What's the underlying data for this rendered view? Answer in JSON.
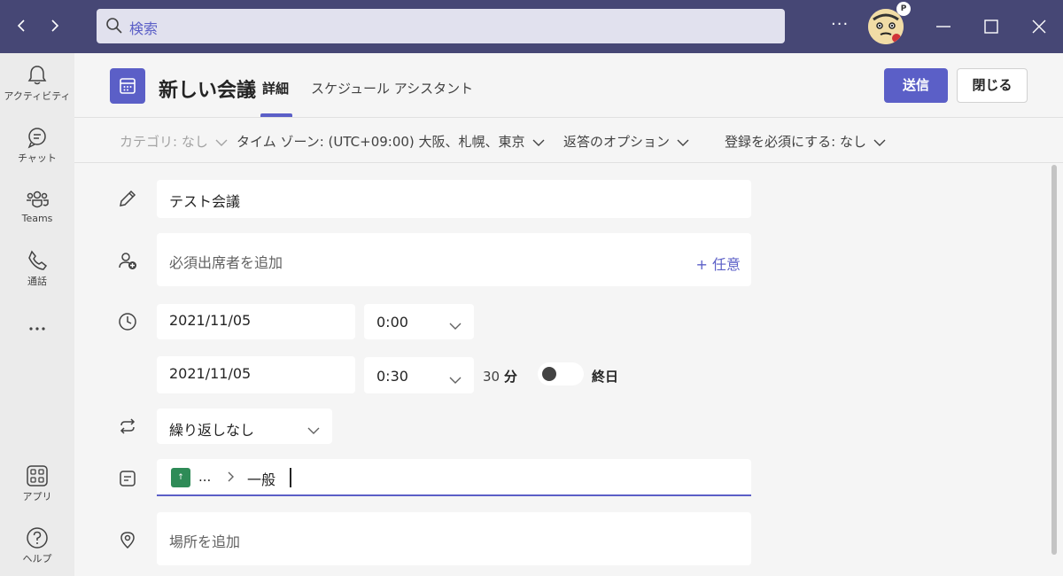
{
  "search": {
    "placeholder": "検索"
  },
  "rail": [
    {
      "label": "アクティビティ",
      "icon": "bell-icon"
    },
    {
      "label": "チャット",
      "icon": "chat-icon"
    },
    {
      "label": "Teams",
      "icon": "teams-icon"
    },
    {
      "label": "通話",
      "icon": "phone-icon"
    },
    {
      "label": "アプリ",
      "icon": "apps-icon"
    },
    {
      "label": "ヘルプ",
      "icon": "help-icon"
    }
  ],
  "user": {
    "presence_badge": "P"
  },
  "header": {
    "title": "新しい会議",
    "tabs": [
      {
        "label": "詳細",
        "active": true
      },
      {
        "label": "スケジュール アシスタント",
        "active": false
      }
    ],
    "send_label": "送信",
    "close_label": "閉じる"
  },
  "options": {
    "category": "カテゴリ: なし",
    "timezone": "タイム ゾーン: (UTC+09:00) 大阪、札幌、東京",
    "response": "返答のオプション",
    "registration": "登録を必須にする: なし"
  },
  "form": {
    "title_value": "テスト会議",
    "attendees_placeholder": "必須出席者を追加",
    "optional_link": "+ 任意",
    "start_date": "2021/11/05",
    "start_time": "0:00",
    "end_date": "2021/11/05",
    "end_time": "0:30",
    "duration_value": "30",
    "duration_unit": "分",
    "all_day_label": "終日",
    "all_day_on": false,
    "recurrence": "繰り返しなし",
    "channel_team": "...",
    "channel_name": "一般",
    "location_placeholder": "場所を追加"
  },
  "colors": {
    "titlebar": "#464775",
    "accent": "#5b5fc7",
    "rail": "#ebebeb",
    "team_icon": "#2e8b57"
  }
}
